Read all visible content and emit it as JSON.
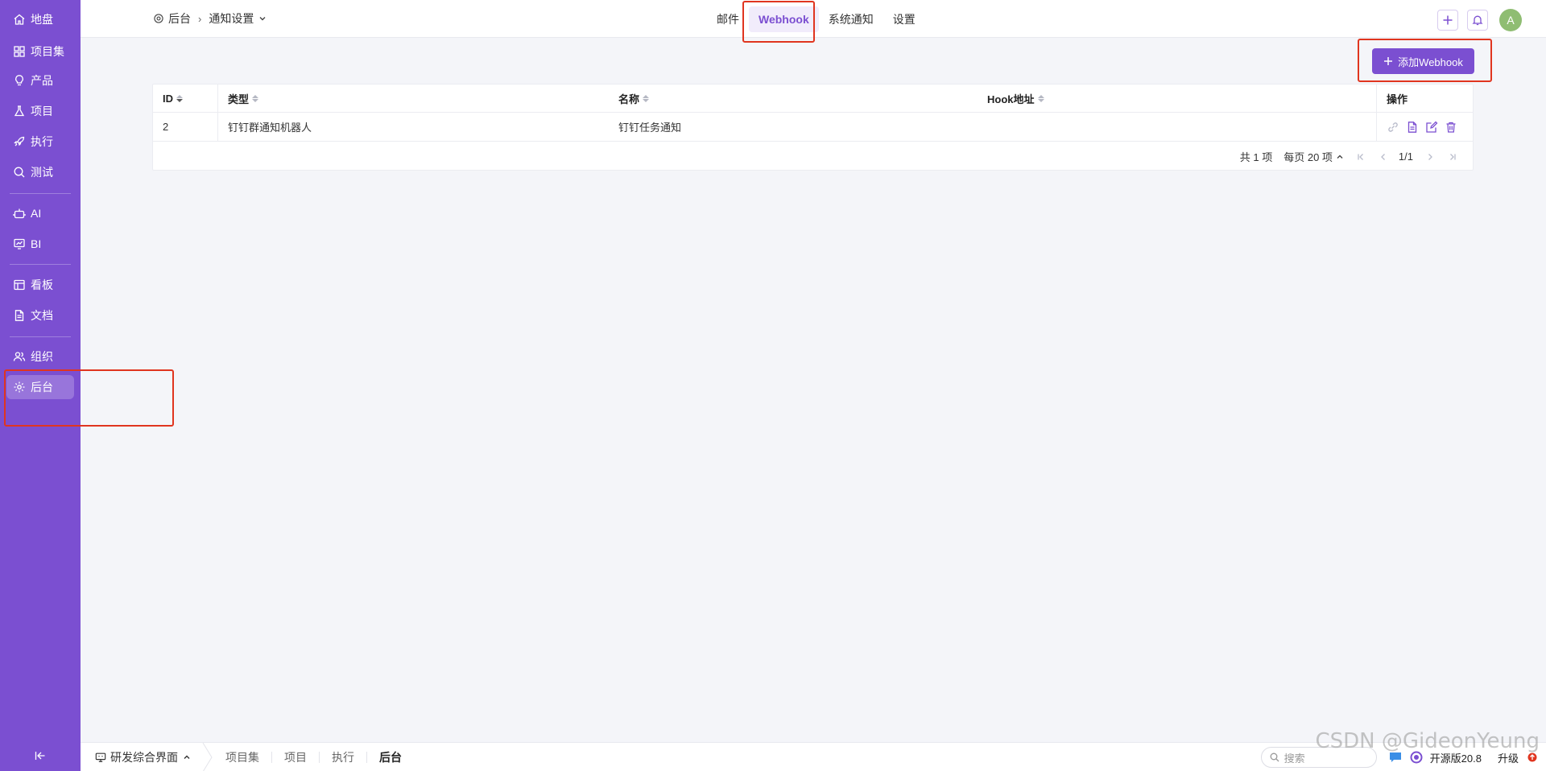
{
  "sidebar": {
    "items": [
      {
        "label": "地盘",
        "icon": "home-icon"
      },
      {
        "label": "项目集",
        "icon": "grid-icon"
      },
      {
        "label": "产品",
        "icon": "lightbulb-icon"
      },
      {
        "label": "项目",
        "icon": "flask-icon"
      },
      {
        "label": "执行",
        "icon": "rocket-icon"
      },
      {
        "label": "测试",
        "icon": "bug-search-icon"
      },
      {
        "label": "AI",
        "icon": "robot-icon"
      },
      {
        "label": "BI",
        "icon": "chart-icon"
      },
      {
        "label": "看板",
        "icon": "kanban-icon"
      },
      {
        "label": "文档",
        "icon": "document-icon"
      },
      {
        "label": "组织",
        "icon": "users-icon"
      },
      {
        "label": "后台",
        "icon": "gear-icon"
      }
    ],
    "active_index": 11
  },
  "header": {
    "breadcrumb_root": "后台",
    "breadcrumb_current": "通知设置",
    "tabs": [
      {
        "label": "邮件"
      },
      {
        "label": "Webhook"
      },
      {
        "label": "系统通知"
      },
      {
        "label": "设置"
      }
    ],
    "active_tab": 1,
    "avatar_letter": "A"
  },
  "main": {
    "add_button_label": "添加Webhook",
    "table": {
      "columns": [
        "ID",
        "类型",
        "名称",
        "Hook地址",
        "操作"
      ],
      "rows": [
        {
          "id": "2",
          "type": "钉钉群通知机器人",
          "name": "钉钉任务通知",
          "hook": ""
        }
      ]
    },
    "pager": {
      "total_text": "共 1 项",
      "per_page_text": "每页 20 项",
      "page_text": "1/1"
    }
  },
  "footer": {
    "switcher_label": "研发综合界面",
    "crumbs": [
      "项目集",
      "项目",
      "执行",
      "后台"
    ],
    "search_placeholder": "搜索",
    "version": "开源版20.8",
    "upgrade": "升级"
  },
  "watermark": "CSDN @GideonYeung",
  "colors": {
    "primary": "#7b4fd1",
    "annotation": "#e0351f"
  }
}
